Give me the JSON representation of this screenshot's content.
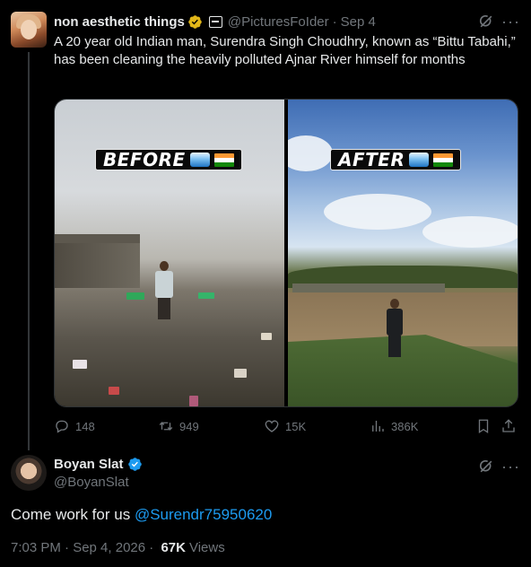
{
  "quoted_tweet": {
    "author_name": "non aesthetic things",
    "handle": "@PicturesFoIder",
    "separator": "·",
    "date": "Sep 4",
    "text": "A 20 year old Indian man, Surendra Singh Choudhry, known as “Bittu Tabahi,” has been cleaning the heavily polluted Ajnar River himself for months",
    "images": [
      {
        "label": "BEFORE"
      },
      {
        "label": "AFTER"
      }
    ],
    "stats": {
      "replies": "148",
      "retweets": "949",
      "likes": "15K",
      "views": "386K"
    }
  },
  "main_tweet": {
    "author_name": "Boyan Slat",
    "handle": "@BoyanSlat",
    "text_prefix": "Come work for us ",
    "mention": "@Surendr75950620",
    "timestamp": "7:03 PM · Sep 4, 2026 · ",
    "views_count": "67K",
    "views_label": "Views"
  },
  "colors": {
    "background": "#000000",
    "text_primary": "#e7e9ea",
    "text_secondary": "#71767b",
    "accent_blue": "#1d9bf0",
    "verified_gold": "#e2b719",
    "border": "#2f3336"
  },
  "icons": [
    "grok-icon",
    "more-icon",
    "reply-icon",
    "retweet-icon",
    "like-icon",
    "views-icon",
    "bookmark-icon",
    "share-icon",
    "verified-badge-icon",
    "affiliate-badge-icon"
  ]
}
